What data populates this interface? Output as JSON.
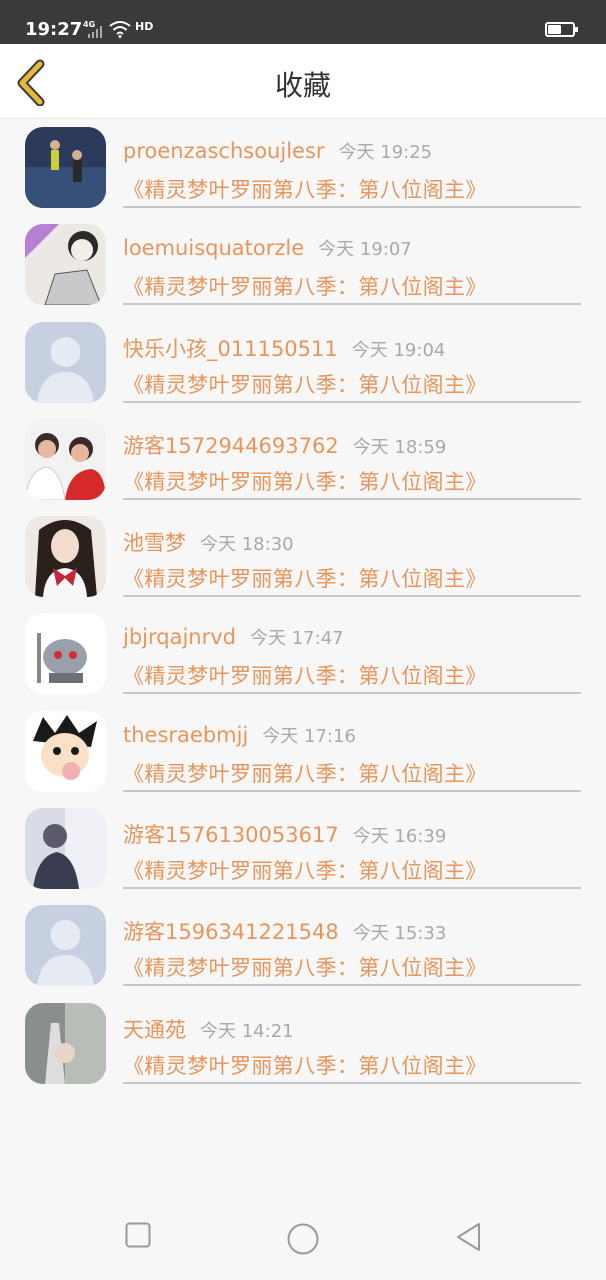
{
  "status_bar": {
    "time": "19:27",
    "network": "4G",
    "hd": "HD"
  },
  "header": {
    "title": "收藏"
  },
  "items": [
    {
      "name": "proenzaschsoujlesr",
      "time": "今天 19:25",
      "book": "《精灵梦叶罗丽第八季：第八位阁主》",
      "avatar_icon": "photo-avatar-icon"
    },
    {
      "name": "loemuisquatorzle",
      "time": "今天 19:07",
      "book": "《精灵梦叶罗丽第八季：第八位阁主》",
      "avatar_icon": "drawing-avatar-icon"
    },
    {
      "name": "快乐小孩_011150511",
      "time": "今天 19:04",
      "book": "《精灵梦叶罗丽第八季：第八位阁主》",
      "avatar_icon": "default-avatar-icon"
    },
    {
      "name": "游客1572944693762",
      "time": "今天 18:59",
      "book": "《精灵梦叶罗丽第八季：第八位阁主》",
      "avatar_icon": "photo-avatar-icon"
    },
    {
      "name": "池雪梦",
      "time": "今天 18:30",
      "book": "《精灵梦叶罗丽第八季：第八位阁主》",
      "avatar_icon": "photo-avatar-icon"
    },
    {
      "name": "jbjrqajnrvd",
      "time": "今天 17:47",
      "book": "《精灵梦叶罗丽第八季：第八位阁主》",
      "avatar_icon": "robot-avatar-icon"
    },
    {
      "name": "thesraebmjj",
      "time": "今天 17:16",
      "book": "《精灵梦叶罗丽第八季：第八位阁主》",
      "avatar_icon": "cartoon-avatar-icon"
    },
    {
      "name": "游客1576130053617",
      "time": "今天 16:39",
      "book": "《精灵梦叶罗丽第八季：第八位阁主》",
      "avatar_icon": "photo-avatar-icon"
    },
    {
      "name": "游客1596341221548",
      "time": "今天 15:33",
      "book": "《精灵梦叶罗丽第八季：第八位阁主》",
      "avatar_icon": "default-avatar-icon"
    },
    {
      "name": "天通苑",
      "time": "今天 14:21",
      "book": "《精灵梦叶罗丽第八季：第八位阁主》",
      "avatar_icon": "photo-avatar-icon"
    }
  ],
  "colors": {
    "accent": "#e8955b",
    "back_arrow": "#e8b83a",
    "time_text": "#a9a9a9",
    "status_bar": "#3a3a3a"
  }
}
